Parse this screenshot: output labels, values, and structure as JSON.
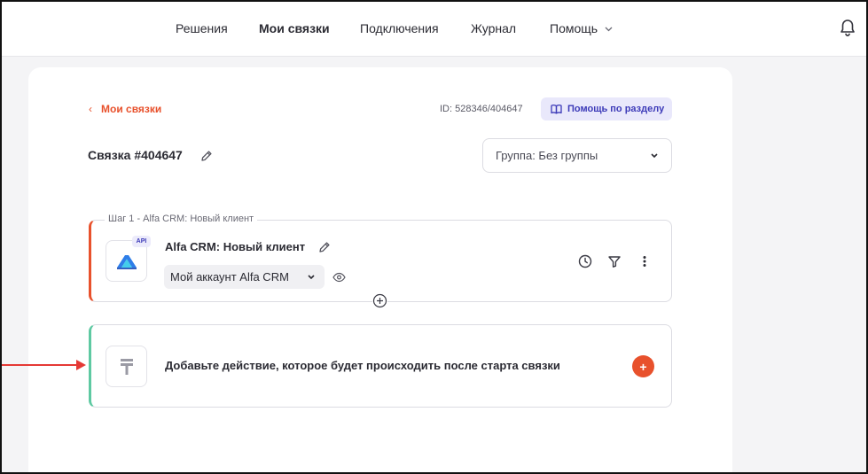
{
  "nav": {
    "items": [
      {
        "label": "Решения"
      },
      {
        "label": "Мои связки"
      },
      {
        "label": "Подключения"
      },
      {
        "label": "Журнал"
      },
      {
        "label": "Помощь"
      }
    ]
  },
  "page": {
    "back_label": "Мои связки",
    "id_text": "ID: 528346/404647",
    "help_label": "Помощь по разделу",
    "bundle_title": "Связка #404647",
    "group_select": "Группа: Без группы"
  },
  "step": {
    "legend": "Шаг 1 - Alfa CRM: Новый клиент",
    "badge": "API",
    "title": "Alfa CRM: Новый клиент",
    "account": "Мой аккаунт Alfa CRM"
  },
  "action": {
    "prompt": "Добавьте действие, которое будет происходить после старта связки",
    "add_symbol": "+"
  },
  "colors": {
    "accent": "#e8512c",
    "step_border": "#e8512c",
    "action_border": "#5ec9a2",
    "help_bg": "#e9e8fb",
    "help_text": "#3c3ab8",
    "annotation_arrow": "#e53935"
  },
  "icons": [
    "bell-icon",
    "chevron-down-icon",
    "chevron-left-icon",
    "book-icon",
    "pencil-icon",
    "alfa-crm-logo",
    "eye-icon",
    "clock-icon",
    "filter-icon",
    "more-vertical-icon",
    "plus-circle-icon",
    "text-tool-icon",
    "plus-icon"
  ]
}
